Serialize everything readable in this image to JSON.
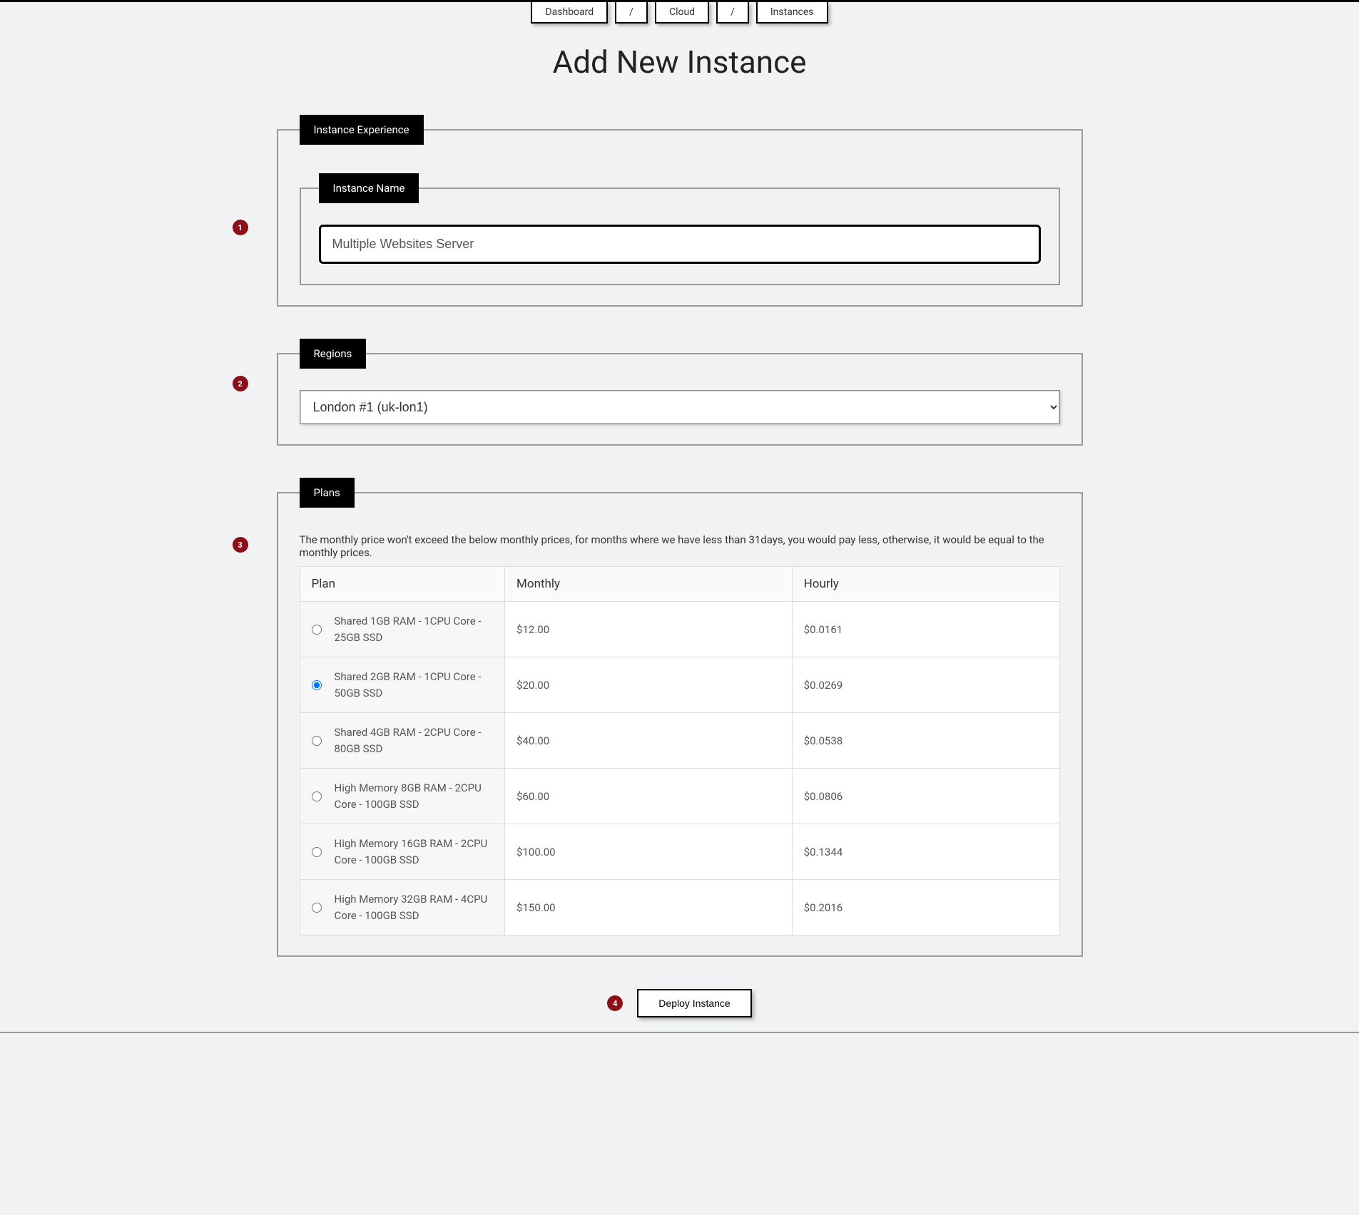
{
  "breadcrumbs": [
    "Dashboard",
    "/",
    "Cloud",
    "/",
    "Instances"
  ],
  "page_title": "Add New Instance",
  "experience": {
    "legend": "Instance Experience",
    "name_legend": "Instance Name",
    "name_value": "Multiple Websites Server"
  },
  "regions": {
    "legend": "Regions",
    "selected": "London #1 (uk-lon1)"
  },
  "plans": {
    "legend": "Plans",
    "note": "The monthly price won't exceed the below monthly prices, for months where we have less than 31days, you would pay less, otherwise, it would be equal to the monthly prices.",
    "headers": {
      "plan": "Plan",
      "monthly": "Monthly",
      "hourly": "Hourly"
    },
    "rows": [
      {
        "label": "Shared 1GB RAM - 1CPU Core - 25GB SSD",
        "monthly": "$12.00",
        "hourly": "$0.0161",
        "selected": false
      },
      {
        "label": "Shared 2GB RAM - 1CPU Core - 50GB SSD",
        "monthly": "$20.00",
        "hourly": "$0.0269",
        "selected": true
      },
      {
        "label": "Shared 4GB RAM - 2CPU Core - 80GB SSD",
        "monthly": "$40.00",
        "hourly": "$0.0538",
        "selected": false
      },
      {
        "label": "High Memory 8GB RAM - 2CPU Core - 100GB SSD",
        "monthly": "$60.00",
        "hourly": "$0.0806",
        "selected": false
      },
      {
        "label": "High Memory 16GB RAM - 2CPU Core - 100GB SSD",
        "monthly": "$100.00",
        "hourly": "$0.1344",
        "selected": false
      },
      {
        "label": "High Memory 32GB RAM - 4CPU Core - 100GB SSD",
        "monthly": "$150.00",
        "hourly": "$0.2016",
        "selected": false
      }
    ]
  },
  "deploy_label": "Deploy Instance",
  "step_markers": [
    "1",
    "2",
    "3",
    "4"
  ]
}
